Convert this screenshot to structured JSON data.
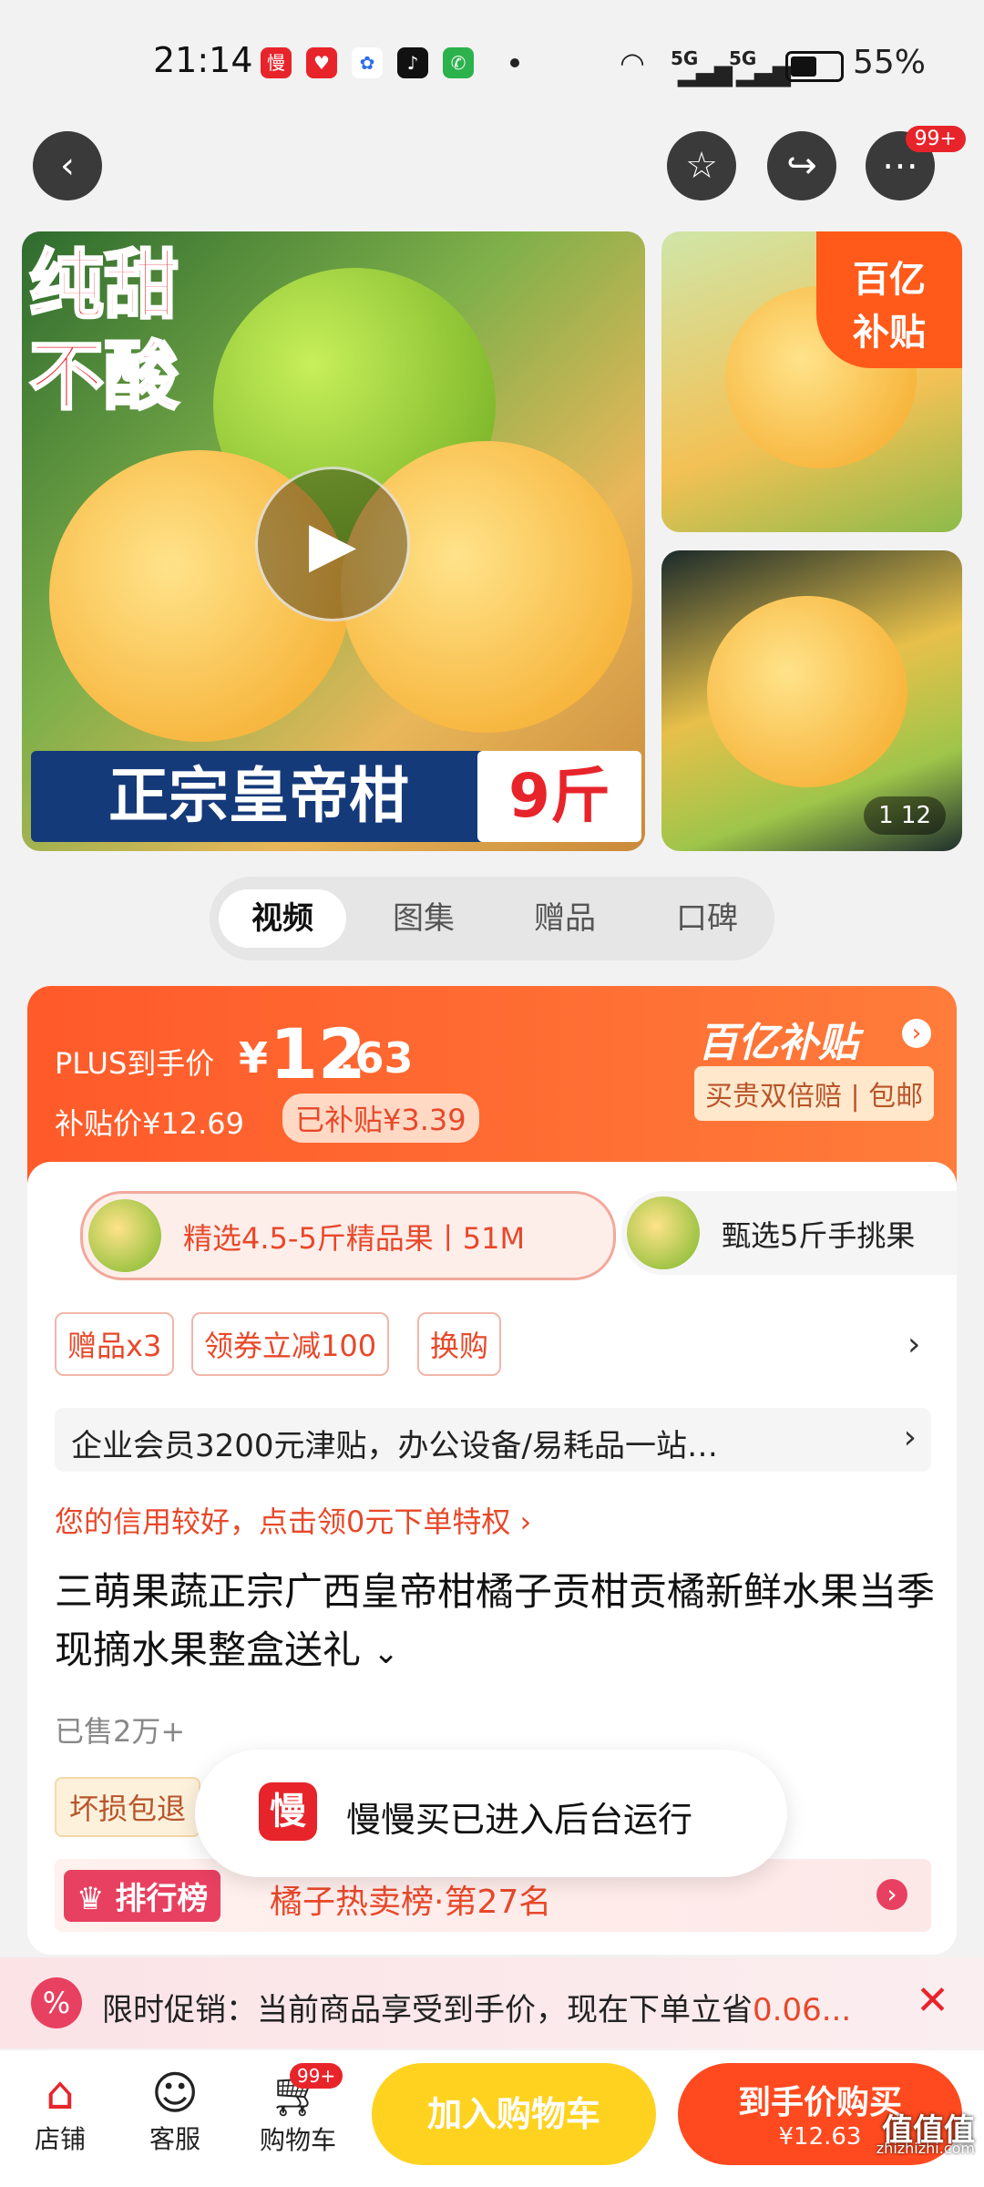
{
  "status_bar": {
    "time": "21:14",
    "signal_1": "5G",
    "signal_2": "5G",
    "battery": "55%"
  },
  "header": {
    "more_badge": "99+"
  },
  "gallery": {
    "main_text_1": "纯甜",
    "main_text_2": "不酸",
    "main_banner": "正宗皇帝柑",
    "main_banner_weight": "9斤",
    "subsidy_badge_1": "百亿",
    "subsidy_badge_2": "补贴",
    "page_counter": "1 12"
  },
  "media_tabs": [
    "视频",
    "图集",
    "赠品",
    "口碑"
  ],
  "price": {
    "plus_label": "PLUS到手价",
    "plus_currency": "¥",
    "plus_integer": "12",
    "plus_decimal": ".63",
    "subsidy_price": "补贴价¥12.69",
    "subsidized_amount": "已补贴¥3.39",
    "brand_badge": "百亿补贴",
    "guarantee": "买贵双倍赔 | 包邮"
  },
  "variants": [
    {
      "label": "精选4.5-5斤精品果丨51M",
      "selected": true
    },
    {
      "label": "甄选5斤手挑果",
      "selected": false
    }
  ],
  "promos": {
    "tags": [
      "赠品x3",
      "领券立减100",
      "换购"
    ],
    "enterprise": "企业会员3200元津贴，办公设备/易耗品一站…",
    "credit": "您的信用较好，点击领0元下单特权 ›"
  },
  "product": {
    "title": "三萌果蔬正宗广西皇帝柑橘子贡柑贡橘新鲜水果当季现摘水果整盒送礼",
    "sold": "已售2万+",
    "guarantee_tag": "坏损包退",
    "rank_label": "排行榜",
    "rank_text": "橘子热卖榜·第27名"
  },
  "toast": {
    "icon_char": "慢",
    "message": "慢慢买已进入后台运行"
  },
  "limited_promo": {
    "text_prefix": "限时促销：当前商品享受到手价，现在下单立省",
    "amount": "0.06..."
  },
  "bottom_bar": {
    "store": "店铺",
    "service": "客服",
    "cart": "购物车",
    "cart_badge": "99+",
    "add_to_cart": "加入购物车",
    "buy_now": "到手价购买",
    "buy_price": "¥12.63",
    "watermark": "值值值",
    "watermark_domain": "zhizhizhi.com"
  },
  "colors": {
    "accent": "#ff5a2a",
    "brand_red": "#e8242b",
    "yellow_btn": "#ffd21f",
    "variant_border": "#f2a89b"
  }
}
